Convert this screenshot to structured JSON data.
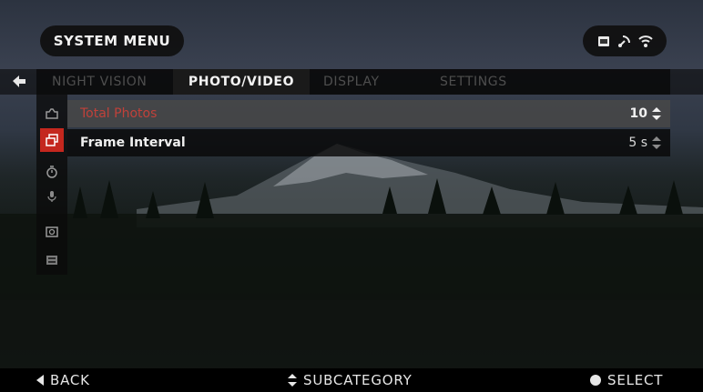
{
  "header": {
    "title": "SYSTEM MENU",
    "status_icons": [
      "sd-card-icon",
      "gps-signal-icon",
      "wifi-icon"
    ]
  },
  "tabs": [
    {
      "label": "NIGHT VISION",
      "active": false
    },
    {
      "label": "PHOTO/VIDEO",
      "active": true
    },
    {
      "label": "DISPLAY",
      "active": false
    },
    {
      "label": "SETTINGS",
      "active": false
    }
  ],
  "side_icons": [
    {
      "name": "camera-icon",
      "active": false
    },
    {
      "name": "photo-gallery-icon",
      "active": true
    },
    {
      "name": "timer-icon",
      "active": false
    },
    {
      "name": "microphone-icon",
      "active": false
    },
    {
      "name": "screen-capture-icon",
      "active": false
    },
    {
      "name": "film-icon",
      "active": false
    }
  ],
  "menu": {
    "rows": [
      {
        "label": "Total Photos",
        "value": "10"
      },
      {
        "label": "Frame Interval",
        "value": "5 s"
      }
    ]
  },
  "footer": {
    "back": "BACK",
    "subcategory": "SUBCATEGORY",
    "select": "SELECT"
  },
  "colors": {
    "accent": "#c4271e",
    "highlight_row": "#484848",
    "panel": "#0a0a0a"
  }
}
